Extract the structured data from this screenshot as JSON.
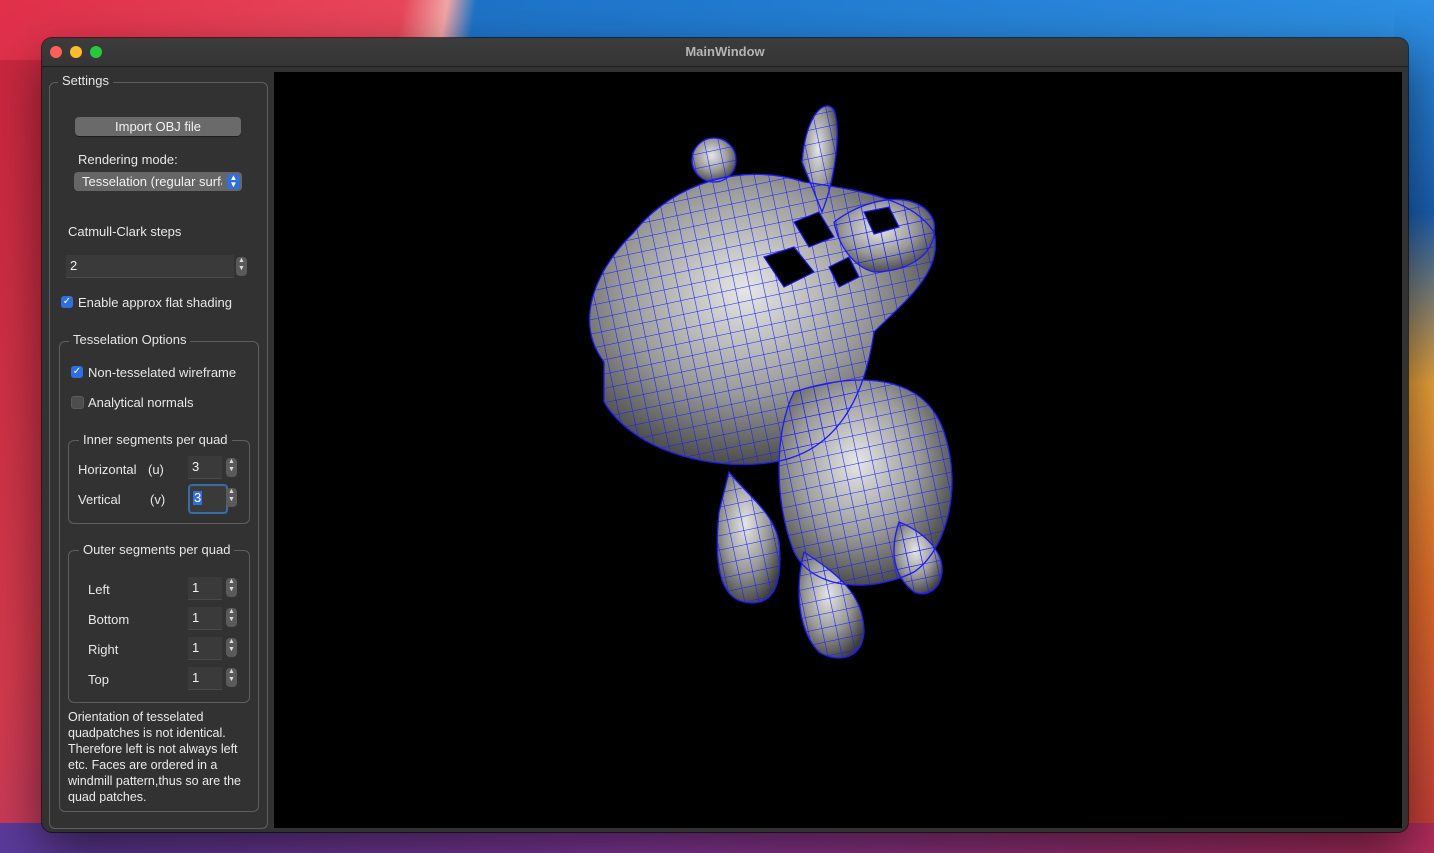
{
  "window": {
    "title": "MainWindow"
  },
  "settings": {
    "group_title": "Settings",
    "import_button": "Import OBJ file",
    "rendering_mode_label": "Rendering mode:",
    "rendering_mode_value": "Tesselation (regular surfaces)",
    "catmull_clark_label": "Catmull-Clark steps",
    "catmull_clark_value": "2",
    "flat_shading": {
      "label": "Enable approx flat shading",
      "checked": true
    }
  },
  "tesselation": {
    "group_title": "Tesselation Options",
    "non_tesselated_wireframe": {
      "label": "Non-tesselated wireframe",
      "checked": true
    },
    "analytical_normals": {
      "label": "Analytical normals",
      "checked": false
    },
    "inner": {
      "title": "Inner segments per quad",
      "horizontal_label": "Horizontal",
      "horizontal_axis": "(u)",
      "horizontal_value": "3",
      "vertical_label": "Vertical",
      "vertical_axis": "(v)",
      "vertical_value": "3"
    },
    "outer": {
      "title": "Outer segments per quad",
      "left_label": "Left",
      "left_value": "1",
      "bottom_label": "Bottom",
      "bottom_value": "1",
      "right_label": "Right",
      "right_value": "1",
      "top_label": "Top",
      "top_value": "1"
    },
    "note": "Orientation of tesselated quadpatches is not identical. Therefore left is not always left etc. Faces are ordered in a windmill pattern,thus so are the quad patches."
  },
  "viewport": {
    "background": "#000000",
    "wire_color": "#1a1aff",
    "model": "cow mesh"
  }
}
